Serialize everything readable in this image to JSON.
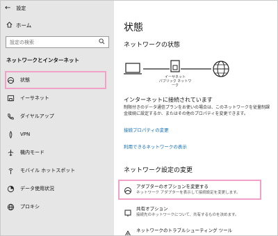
{
  "sidebar": {
    "window_title": "設定",
    "home_label": "ホーム",
    "search_placeholder": "設定の検索",
    "section_title": "ネットワークとインターネット",
    "items": [
      {
        "label": "状態",
        "icon": "status-icon"
      },
      {
        "label": "イーサネット",
        "icon": "ethernet-icon"
      },
      {
        "label": "ダイヤルアップ",
        "icon": "phone-icon"
      },
      {
        "label": "VPN",
        "icon": "vpn-icon"
      },
      {
        "label": "機内モード",
        "icon": "airplane-icon"
      },
      {
        "label": "モバイル ホットスポット",
        "icon": "hotspot-icon"
      },
      {
        "label": "データ使用状況",
        "icon": "data-usage-icon"
      },
      {
        "label": "プロキシ",
        "icon": "globe-icon"
      }
    ]
  },
  "main": {
    "title": "状態",
    "network_status_heading": "ネットワークの状態",
    "diagram_label": "イーサネット\nパブリック ネットワーク",
    "connected_title": "インターネットに接続されています",
    "connected_body": "制限付きのデータ通信プランをお使いの場合は、このネットワークを従量制課金接続に設定するか、またはその他のプロパティを変更できます。",
    "link_properties": "接続プロパティの変更",
    "link_available": "利用できるネットワークの表示",
    "change_heading": "ネットワーク設定の変更",
    "settings": [
      {
        "title": "アダプターのオプションを変更する",
        "desc": "ネットワーク アダプターを表示して接続設定を変更します。",
        "icon": "adapter-icon"
      },
      {
        "title": "共有オプション",
        "desc": "接続先のネットワークについて、共有するものを決めます。",
        "icon": "sharing-icon"
      },
      {
        "title": "ネットワークのトラブルシューティング ツール",
        "desc": "",
        "icon": "troubleshoot-icon"
      }
    ]
  },
  "colors": {
    "sidebar_bg": "#e6e6e6",
    "link": "#0a6ab5",
    "highlight": "#f2a0c8"
  }
}
